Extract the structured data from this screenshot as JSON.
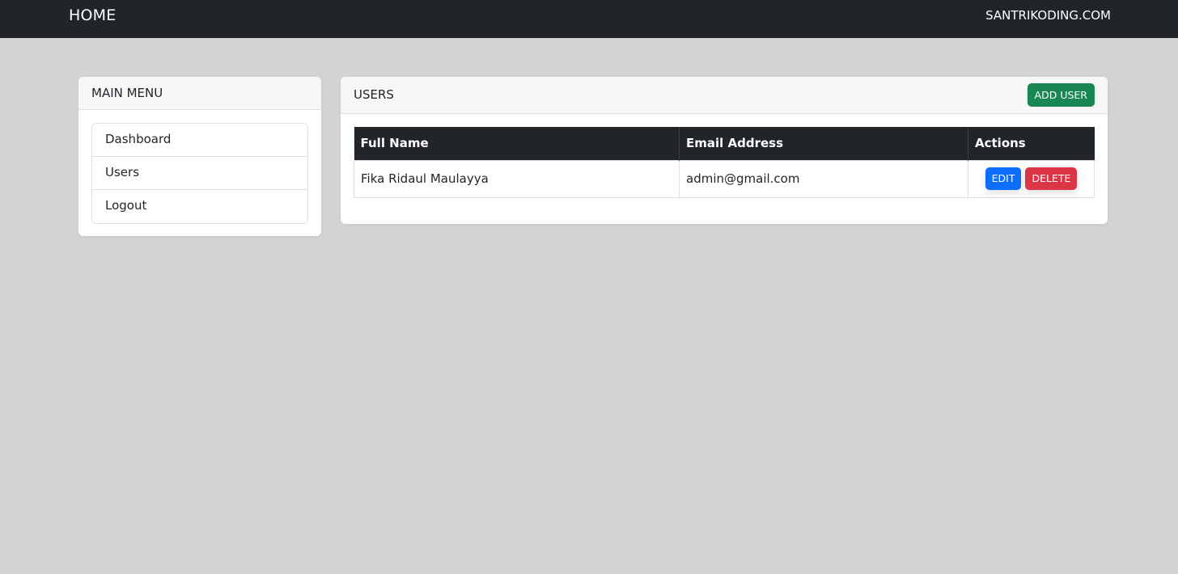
{
  "navbar": {
    "brand": "HOME",
    "right_link": "SANTRIKODING.COM"
  },
  "sidebar": {
    "title": "MAIN MENU",
    "items": [
      {
        "label": "Dashboard"
      },
      {
        "label": "Users"
      },
      {
        "label": "Logout"
      }
    ]
  },
  "users": {
    "title": "USERS",
    "add_label": "ADD USER",
    "columns": [
      "Full Name",
      "Email Address",
      "Actions"
    ],
    "rows": [
      {
        "full_name": "Fika Ridaul Maulayya",
        "email": "admin@gmail.com",
        "edit_label": "EDIT",
        "delete_label": "DELETE"
      }
    ]
  },
  "colors": {
    "navbar": "#212529",
    "background": "#d3d3d3",
    "add": "#198754",
    "edit": "#0d6efd",
    "delete": "#dc3545"
  }
}
